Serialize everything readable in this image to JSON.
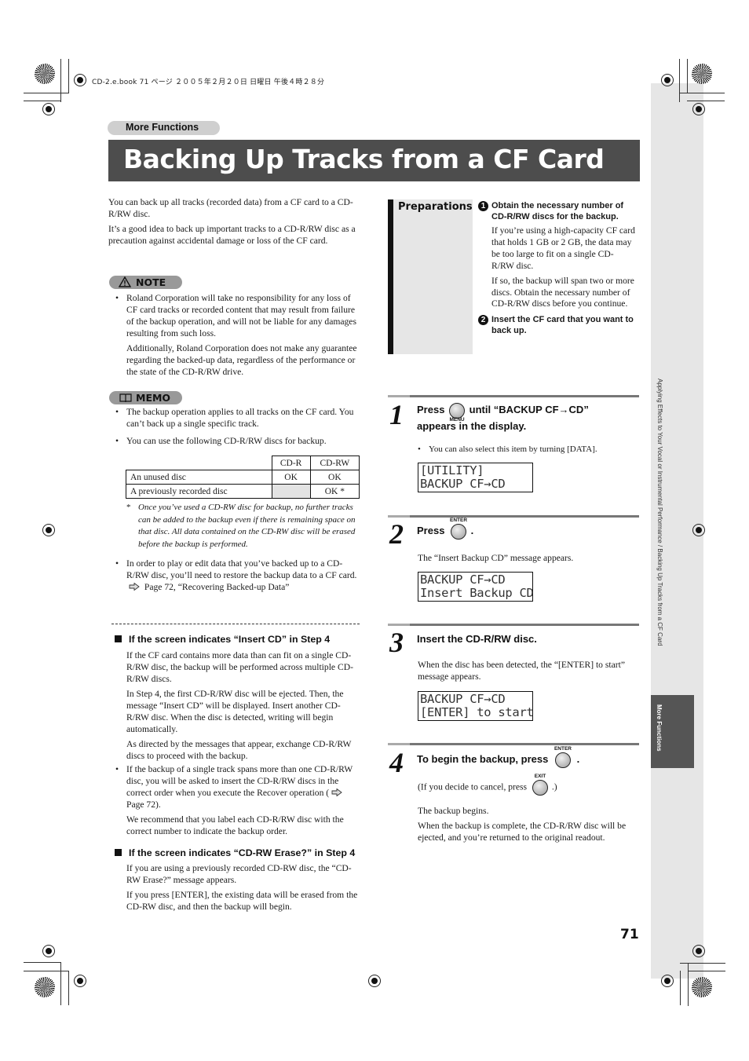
{
  "print_header": "CD-2.e.book  71 ページ  ２００５年２月２０日  日曜日  午後４時２８分",
  "section_label": "More Functions",
  "title": "Backing Up Tracks from a CF Card",
  "side_tab": {
    "chapter_text": "Applying Effects to Your Vocal or Instrumental Performance / Backing Up Tracks from a CF Card",
    "section_text": "More Functions"
  },
  "intro": [
    "You can back up all tracks (recorded data) from a CF card to a CD-R/RW disc.",
    "It’s a good idea to back up important tracks to a CD-R/RW disc as a precaution against accidental damage or loss of the CF card."
  ],
  "note": {
    "label": "NOTE",
    "icon": "warning-triangle-icon",
    "paragraphs": [
      "Roland Corporation will take no responsibility for any loss of CF card tracks or recorded content that may result from failure of the backup operation, and will not be liable for any damages resulting from such loss.",
      "Additionally, Roland Corporation does not make any guarantee regarding the backed-up data, regardless of the performance or the state of the CD-R/RW drive."
    ]
  },
  "memo": {
    "label": "MEMO",
    "icon": "book-icon",
    "bullets": [
      "The backup operation applies to all tracks on the CF card. You can’t back up a single specific track.",
      "You can use the following CD-R/RW discs for backup."
    ],
    "table": {
      "headers": [
        "",
        "CD-R",
        "CD-RW"
      ],
      "rows": [
        [
          "An unused disc",
          "OK",
          "OK"
        ],
        [
          "A previously recorded disc",
          "",
          "OK *"
        ]
      ]
    },
    "footnote_mark": "*",
    "footnote": "Once you’ve used a CD-RW disc for backup, no further tracks can be added to the backup even if there is remaining space on that disc. All data contained on the CD-RW disc will be erased before the backup is performed.",
    "restore_bullet": "In order to play or edit data that you’ve backed up to a CD-R/RW disc, you’ll need to restore the backup data to a CF card.",
    "restore_ref": "Page 72, “Recovering Backed-up Data”"
  },
  "insert_cd": {
    "heading": "If the screen indicates “Insert CD” in Step 4",
    "paragraphs": [
      "If the CF card contains more data than can fit on a single CD-R/RW disc, the backup will be performed across multiple CD-R/RW discs.",
      "In Step 4, the first CD-R/RW disc will be ejected. Then, the message “Insert CD” will be displayed. Insert another CD-R/RW disc. When the disc is detected, writing will begin automatically.",
      "As directed by the messages that appear, exchange CD-R/RW discs to proceed with the backup."
    ],
    "bullet_pre": "If the backup of a single track spans more than one CD-R/RW disc, you will be asked to insert the CD-R/RW discs in the correct order when you execute the Recover operation (",
    "bullet_ref": "Page 72).",
    "bullet_after": "We recommend that you label each CD-R/RW disc with the correct number to indicate the backup order."
  },
  "cdrw_erase": {
    "heading": "If the screen indicates “CD-RW Erase?” in Step 4",
    "paragraphs": [
      "If you are using a previously recorded CD-RW disc, the “CD-RW Erase?” message appears.",
      "If you press [ENTER], the existing data will be erased from the CD-RW disc, and then the backup will begin."
    ]
  },
  "preparations": {
    "label": "Preparations",
    "items": [
      {
        "num": "1",
        "heading": "Obtain the necessary number of CD-R/RW discs for the backup.",
        "paragraphs": [
          "If you’re using a high-capacity CF card that holds 1 GB or 2 GB, the data may be too large to fit on a single CD-R/RW disc.",
          "If so, the backup will span two or more discs. Obtain the necessary number of CD-R/RW discs before you continue."
        ]
      },
      {
        "num": "2",
        "heading": "Insert the CF card that you want to back up."
      }
    ]
  },
  "steps": [
    {
      "num": "1",
      "head_pre": "Press",
      "button": "MENU",
      "head_post": "until “BACKUP CF→CD” appears in the display.",
      "bullet": "You can also select this item by turning [DATA].",
      "lcd": [
        "[UTILITY]",
        "BACKUP CF→CD"
      ]
    },
    {
      "num": "2",
      "head_pre": "Press",
      "button": "ENTER",
      "head_post": ".",
      "body": "The “Insert Backup CD” message appears.",
      "lcd": [
        "BACKUP CF→CD",
        "Insert Backup CD"
      ]
    },
    {
      "num": "3",
      "head": "Insert the CD-R/RW disc.",
      "body": "When the disc has been detected, the “[ENTER] to start” message appears.",
      "lcd": [
        "BACKUP CF→CD",
        "[ENTER] to start"
      ]
    },
    {
      "num": "4",
      "head_pre": "To begin the backup, press",
      "button": "ENTER",
      "head_post": ".",
      "cancel_pre": "(If you decide to cancel, press",
      "cancel_button": "EXIT",
      "cancel_post": ".)",
      "body": [
        "The backup begins.",
        "When the backup is complete, the CD-R/RW disc will be ejected, and you’re returned to the original readout."
      ]
    }
  ],
  "page_number": "71"
}
